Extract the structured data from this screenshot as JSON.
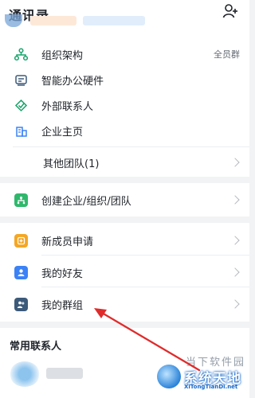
{
  "header": {
    "title": "通讯录",
    "add_icon": "add-person-icon"
  },
  "org_menu": [
    {
      "label": "组织架构",
      "icon": "org-tree-icon",
      "right_text": "全员群"
    },
    {
      "label": "智能办公硬件",
      "icon": "smart-hardware-icon",
      "right_text": ""
    },
    {
      "label": "外部联系人",
      "icon": "external-contact-icon",
      "right_text": ""
    },
    {
      "label": "企业主页",
      "icon": "company-home-icon",
      "right_text": ""
    }
  ],
  "other_teams": {
    "label": "其他团队(1)"
  },
  "create_org": {
    "label": "创建企业/组织/团队",
    "icon": "create-org-icon",
    "color": "#2fb86b"
  },
  "friends_menu": [
    {
      "label": "新成员申请",
      "icon": "new-member-icon",
      "color": "#f5a623"
    },
    {
      "label": "我的好友",
      "icon": "my-friends-icon",
      "color": "#3b82f6"
    },
    {
      "label": "我的群组",
      "icon": "my-groups-icon",
      "color": "#3c5a7a"
    }
  ],
  "frequent_contacts": {
    "title": "常用联系人"
  },
  "watermark": {
    "top_text": "当下软件园",
    "cn_text": "系统天地",
    "en_text": "XiTongTianDi.net"
  },
  "colors": {
    "accent": "#1890ff",
    "arrow": "#e02b2b"
  }
}
